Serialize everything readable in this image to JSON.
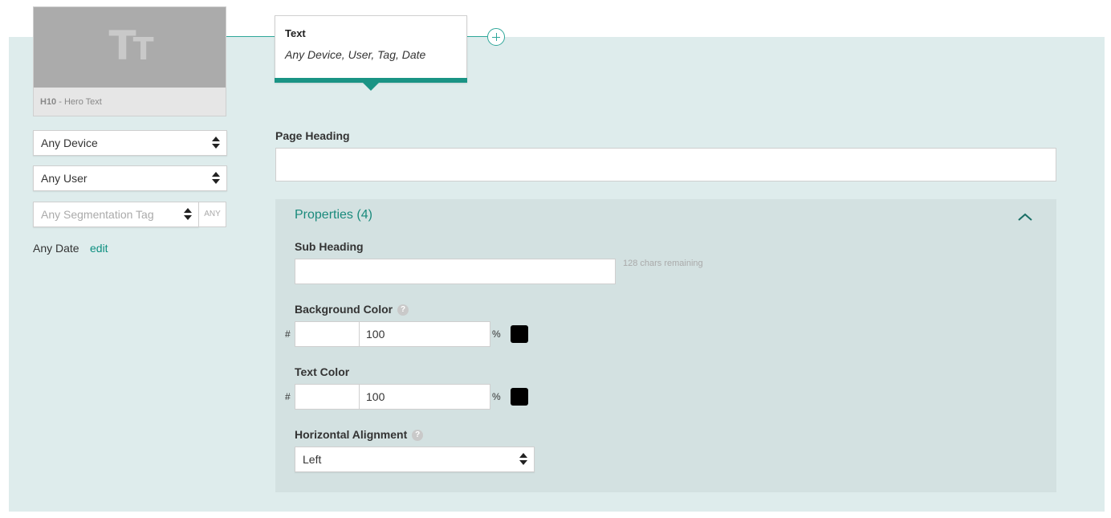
{
  "thumbnail": {
    "icon": "text-type-icon",
    "icon_glyph_big": "T",
    "icon_glyph_small": "T",
    "code": "H10",
    "name": " - Hero Text"
  },
  "filters": {
    "device": "Any Device",
    "user": "Any User",
    "segmentation_placeholder": "Any Segmentation Tag",
    "segmentation_badge": "ANY",
    "date": "Any Date",
    "date_edit": "edit"
  },
  "popup": {
    "title": "Text",
    "subtitle": "Any Device, User, Tag, Date"
  },
  "page_heading": {
    "label": "Page Heading",
    "value": ""
  },
  "properties": {
    "title": "Properties (4)",
    "sub_heading": {
      "label": "Sub Heading",
      "value": "",
      "remaining": "128 chars remaining"
    },
    "background_color": {
      "label": "Background Color",
      "hash": "#",
      "hex": "",
      "opacity": "100",
      "pct": "%",
      "swatch": "#000000"
    },
    "text_color": {
      "label": "Text Color",
      "hash": "#",
      "hex": "",
      "opacity": "100",
      "pct": "%",
      "swatch": "#000000"
    },
    "horizontal_alignment": {
      "label": "Horizontal Alignment",
      "value": "Left"
    },
    "help_glyph": "?"
  },
  "colors": {
    "accent": "#1a9485",
    "panel_bg": "#deecec",
    "props_bg": "#d3e1e1"
  }
}
